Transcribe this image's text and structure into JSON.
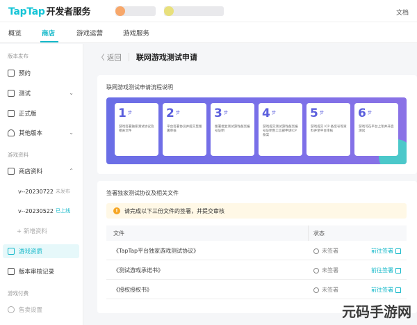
{
  "header": {
    "logo_brand": "TapTap",
    "logo_suffix": "开发者服务",
    "docs_label": "文档"
  },
  "tabs": [
    {
      "label": "概览"
    },
    {
      "label": "商店"
    },
    {
      "label": "游戏运营"
    },
    {
      "label": "游戏服务"
    }
  ],
  "sidebar": {
    "section_release": "版本发布",
    "items": {
      "preorder": "预约",
      "test": "测试",
      "official": "正式版",
      "other_versions": "其他版本"
    },
    "section_store": "游戏资料",
    "store_items": {
      "store_info": "商店资料",
      "v1_name": "v--20230722",
      "v1_tag": "未发布",
      "v2_name": "v--20230522",
      "v2_tag": "已上线",
      "add": "+ 新增资料",
      "game_qual": "游戏资质",
      "review_log": "版本审核记录"
    },
    "section_pay": "游戏付费",
    "pay_items": {
      "pay_settings": "售卖设置"
    }
  },
  "page": {
    "back_label": "〈 返回",
    "title": "联网游戏测试申请"
  },
  "flow_card": {
    "title": "联网游戏测试申请流程说明",
    "steps": [
      {
        "num": "1",
        "unit": "步",
        "text": "游戏签署独家测试协议及相关文件"
      },
      {
        "num": "2",
        "unit": "步",
        "text": "平台签署协议并提交至版署审核"
      },
      {
        "num": "3",
        "unit": "步",
        "text": "版署批复测试游戏备案编号证明"
      },
      {
        "num": "4",
        "unit": "步",
        "text": "游戏提交测试游戏备案编号证明至工信部申请ICP备案"
      },
      {
        "num": "5",
        "unit": "步",
        "text": "游戏提交 ICP 备案号等资料并至平台审核"
      },
      {
        "num": "6",
        "unit": "步",
        "text": "游戏可在平台上架并开启测试"
      }
    ]
  },
  "files_card": {
    "title": "签署独家测试协议及相关文件",
    "notice": "请完成以下三份文件的签署，并提交审核",
    "col_file": "文件",
    "col_status": "状态",
    "rows": [
      {
        "name": "《TapTap平台独家游戏测试协议》",
        "status": "未签署",
        "action": "前往签署"
      },
      {
        "name": "《测试游戏承诺书》",
        "status": "未签署",
        "action": "前往签署"
      },
      {
        "name": "《授权授权书》",
        "status": "未签署",
        "action": "前往签署"
      }
    ]
  },
  "watermark": "元码手游网",
  "colors": {
    "accent": "#14b8c9",
    "banner": "#6a6ee6",
    "warning": "#f6a623"
  }
}
